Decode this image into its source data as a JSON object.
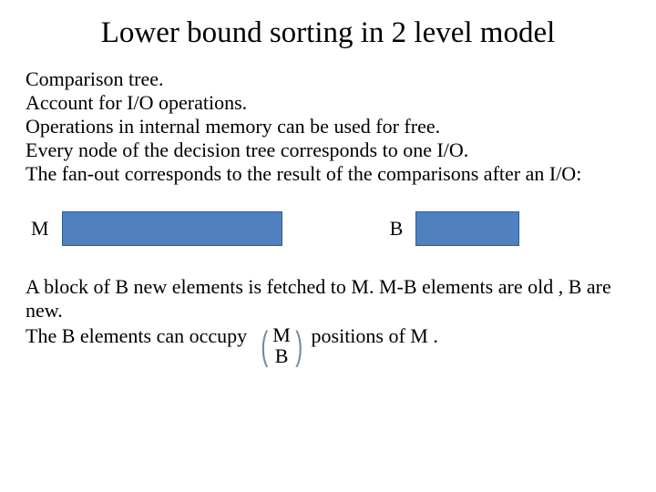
{
  "title": "Lower bound sorting in 2 level model",
  "lines": {
    "l1": "Comparison tree.",
    "l2": "Account for I/O operations.",
    "l3": "Operations in internal memory can be used for free.",
    "l4": "Every node of the decision tree corresponds to one I/O.",
    "l5": "The fan-out corresponds to the result of the comparisons after an I/O:"
  },
  "diagram": {
    "label_m": "M",
    "label_b": "B",
    "bar_color": "#5080c0"
  },
  "footer": {
    "p1a": "A block of B new elements is fetched to M. M-B elements are old , B are new.",
    "lead": "The B elements can occupy ",
    "binom_top": "M",
    "binom_bottom": "B",
    "tail": " positions of M ."
  }
}
